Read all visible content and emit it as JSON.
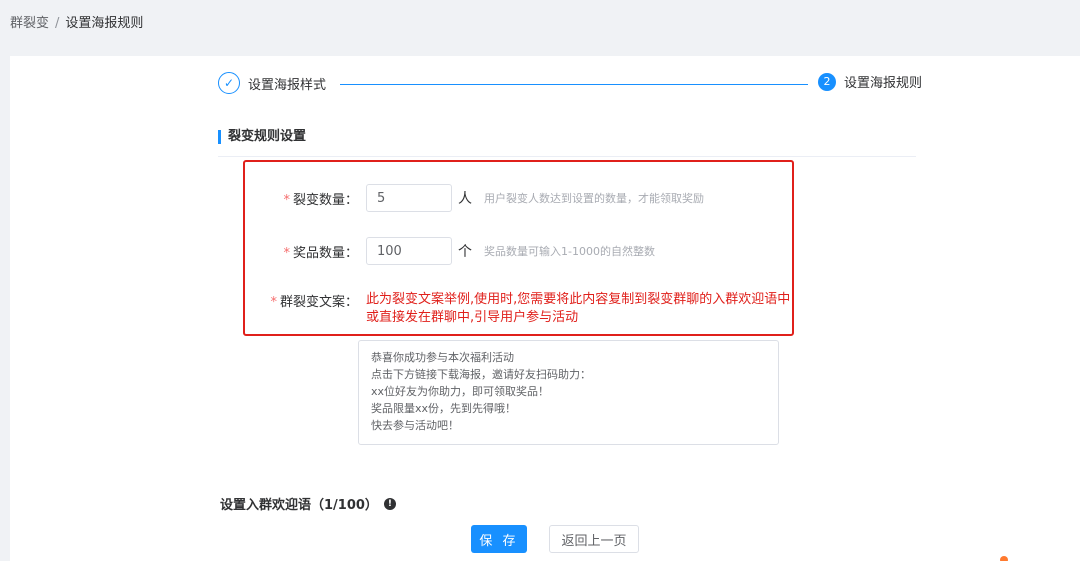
{
  "breadcrumb": {
    "root": "群裂变",
    "separator": "/",
    "current": "设置海报规则"
  },
  "steps": {
    "step1": {
      "label": "设置海报样式",
      "icon": "check-icon"
    },
    "step2": {
      "number": "2",
      "label": "设置海报规则"
    }
  },
  "section": {
    "title": "裂变规则设置"
  },
  "form": {
    "fission_count": {
      "label": "裂变数量：",
      "value": "5",
      "unit": "人",
      "hint": "用户裂变人数达到设置的数量，才能领取奖励"
    },
    "prize_count": {
      "label": "奖品数量：",
      "value": "100",
      "unit": "个",
      "hint": "奖品数量可输入1-1000的自然整数"
    },
    "copy": {
      "label": "群裂变文案：",
      "description": "此为裂变文案举例,使用时,您需要将此内容复制到裂变群聊的入群欢迎语中或直接发在群聊中,引导用户参与活动",
      "lines": [
        "恭喜你成功参与本次福利活动",
        "点击下方链接下载海报，邀请好友扫码助力：",
        "xx位好友为你助力，即可领取奖品！",
        "奖品限量xx份，先到先得哦！",
        "快去参与活动吧！"
      ]
    }
  },
  "welcome": {
    "label": "设置入群欢迎语（1/100）",
    "icon": "info-icon"
  },
  "buttons": {
    "save": "保 存",
    "back": "返回上一页"
  },
  "colors": {
    "primary": "#1890ff",
    "highlight": "#e0201b",
    "required": "#f56c6c"
  }
}
